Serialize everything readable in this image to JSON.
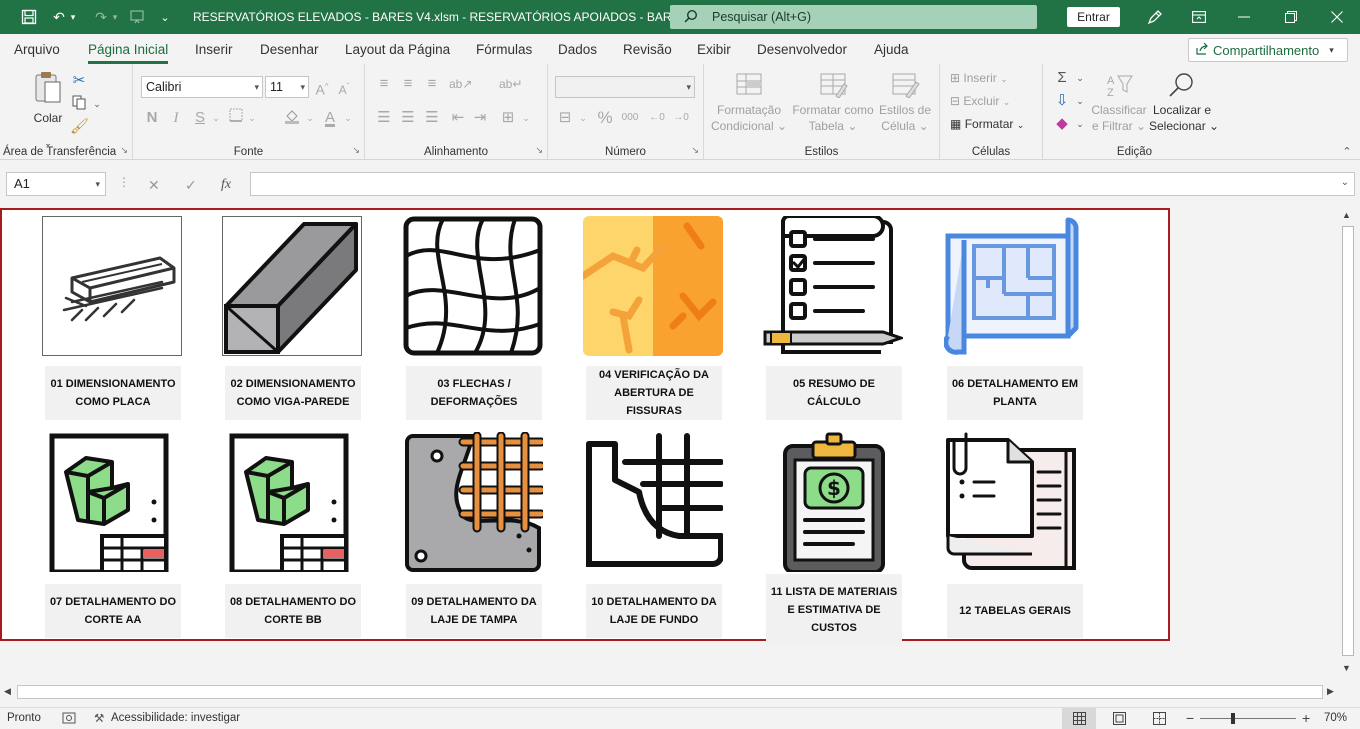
{
  "titlebar": {
    "title": "RESERVATÓRIOS ELEVADOS - BARES V4.xlsm  -  RESERVATÓRIOS APOIADOS - BARES V44",
    "search_placeholder": "Pesquisar (Alt+G)",
    "signin_label": "Entrar",
    "color": "#217346"
  },
  "menu": {
    "tabs": [
      "Arquivo",
      "Página Inicial",
      "Inserir",
      "Desenhar",
      "Layout da Página",
      "Fórmulas",
      "Dados",
      "Revisão",
      "Exibir",
      "Desenvolvedor",
      "Ajuda"
    ],
    "active": "Página Inicial",
    "share_label": "Compartilhamento"
  },
  "ribbon": {
    "clipboard": {
      "label": "Área de Transferência",
      "paste": "Colar"
    },
    "font": {
      "label": "Fonte",
      "name": "Calibri",
      "size": "11",
      "bold": "N",
      "italic": "I",
      "underline": "S"
    },
    "alignment": {
      "label": "Alinhamento"
    },
    "number": {
      "label": "Número",
      "percent": "%",
      "thousands": "000"
    },
    "styles": {
      "label": "Estilos",
      "cond_format": [
        "Formatação",
        "Condicional"
      ],
      "format_table": [
        "Formatar como",
        "Tabela"
      ],
      "cell_styles": [
        "Estilos de",
        "Célula"
      ]
    },
    "cells": {
      "label": "Células",
      "insert": "Inserir",
      "delete": "Excluir",
      "format": "Formatar"
    },
    "editing": {
      "label": "Edição",
      "sort_filter": [
        "Classificar",
        "e Filtrar"
      ],
      "find_select": [
        "Localizar e",
        "Selecionar"
      ]
    }
  },
  "formula_bar": {
    "cell_ref": "A1",
    "fx": "fx",
    "value": ""
  },
  "cards": [
    {
      "label": [
        "01 DIMENSIONAMENTO",
        "COMO PLACA"
      ]
    },
    {
      "label": [
        "02 DIMENSIONAMENTO",
        "COMO VIGA-PAREDE"
      ]
    },
    {
      "label": [
        "03 FLECHAS /",
        "DEFORMAÇÕES"
      ]
    },
    {
      "label": [
        "04 VERIFICAÇÃO DA",
        "ABERTURA DE FISSURAS"
      ]
    },
    {
      "label": [
        "05 RESUMO DE",
        "CÁLCULO"
      ]
    },
    {
      "label": [
        "06 DETALHAMENTO EM",
        "PLANTA"
      ]
    },
    {
      "label": [
        "07 DETALHAMENTO DO",
        "CORTE AA"
      ]
    },
    {
      "label": [
        "08 DETALHAMENTO DO",
        "CORTE BB"
      ]
    },
    {
      "label": [
        "09 DETALHAMENTO DA",
        "LAJE DE TAMPA"
      ]
    },
    {
      "label": [
        "10 DETALHAMENTO DA",
        "LAJE DE FUNDO"
      ]
    },
    {
      "label": [
        "11 LISTA DE MATERIAIS",
        "E ESTIMATIVA DE",
        "CUSTOS"
      ]
    },
    {
      "label": [
        "12 TABELAS GERAIS"
      ]
    }
  ],
  "status": {
    "ready": "Pronto",
    "accessibility": "Acessibilidade: investigar",
    "zoom": "70%"
  }
}
